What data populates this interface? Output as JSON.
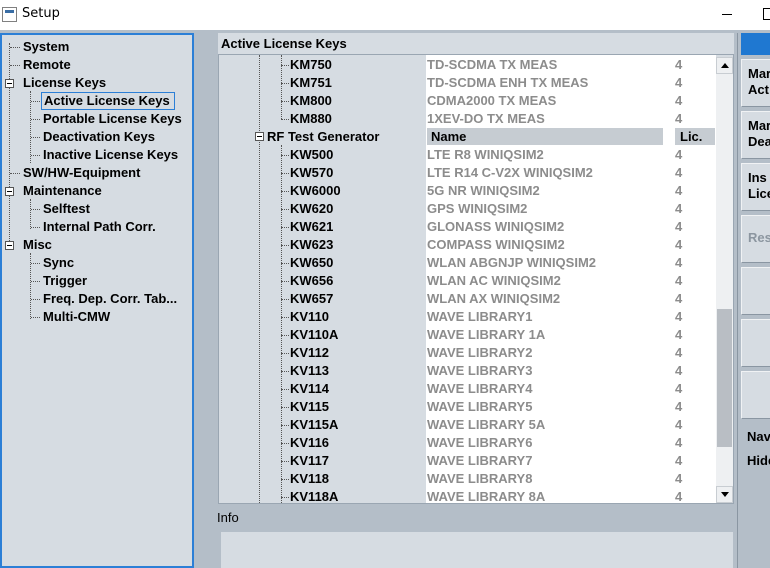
{
  "window": {
    "title": "Setup",
    "controls": [
      "minimize",
      "maximize"
    ]
  },
  "tree": {
    "items": [
      {
        "label": "System",
        "level": 1,
        "expandable": false
      },
      {
        "label": "Remote",
        "level": 1,
        "expandable": false
      },
      {
        "label": "License Keys",
        "level": 0,
        "expandable": true
      },
      {
        "label": "Active License Keys",
        "level": 2,
        "selected": true
      },
      {
        "label": "Portable License Keys",
        "level": 2
      },
      {
        "label": "Deactivation Keys",
        "level": 2
      },
      {
        "label": "Inactive License Keys",
        "level": 2
      },
      {
        "label": "SW/HW-Equipment",
        "level": 1,
        "expandable": false
      },
      {
        "label": "Maintenance",
        "level": 0,
        "expandable": true
      },
      {
        "label": "Selftest",
        "level": 2
      },
      {
        "label": "Internal Path Corr.",
        "level": 2
      },
      {
        "label": "Misc",
        "level": 0,
        "expandable": true
      },
      {
        "label": "Sync",
        "level": 2
      },
      {
        "label": "Trigger",
        "level": 2
      },
      {
        "label": "Freq. Dep. Corr. Tab...",
        "level": 2
      },
      {
        "label": "Multi-CMW",
        "level": 2
      }
    ]
  },
  "main": {
    "header": "Active License Keys",
    "columns": {
      "name": "Name",
      "lic": "Lic."
    },
    "rows_before": [
      {
        "key": "KM750",
        "name": "TD-SCDMA TX MEAS",
        "lic": "4"
      },
      {
        "key": "KM751",
        "name": "TD-SCDMA ENH TX MEAS",
        "lic": "4"
      },
      {
        "key": "KM800",
        "name": "CDMA2000 TX MEAS",
        "lic": "4"
      },
      {
        "key": "KM880",
        "name": "1XEV-DO TX MEAS",
        "lic": "4"
      }
    ],
    "group": "RF Test Generator",
    "rows_after": [
      {
        "key": "KW500",
        "name": "LTE R8 WINIQSIM2",
        "lic": "4"
      },
      {
        "key": "KW570",
        "name": "LTE R14 C-V2X WINIQSIM2",
        "lic": "4"
      },
      {
        "key": "KW6000",
        "name": "5G NR WINIQSIM2",
        "lic": "4"
      },
      {
        "key": "KW620",
        "name": "GPS WINIQSIM2",
        "lic": "4"
      },
      {
        "key": "KW621",
        "name": "GLONASS WINIQSIM2",
        "lic": "4"
      },
      {
        "key": "KW623",
        "name": "COMPASS WINIQSIM2",
        "lic": "4"
      },
      {
        "key": "KW650",
        "name": "WLAN ABGNJP WINIQSIM2",
        "lic": "4"
      },
      {
        "key": "KW656",
        "name": "WLAN AC WINIQSIM2",
        "lic": "4"
      },
      {
        "key": "KW657",
        "name": "WLAN AX WINIQSIM2",
        "lic": "4"
      },
      {
        "key": "KV110",
        "name": "WAVE LIBRARY1",
        "lic": "4"
      },
      {
        "key": "KV110A",
        "name": "WAVE LIBRARY 1A",
        "lic": "4"
      },
      {
        "key": "KV112",
        "name": "WAVE LIBRARY2",
        "lic": "4"
      },
      {
        "key": "KV113",
        "name": "WAVE LIBRARY3",
        "lic": "4"
      },
      {
        "key": "KV114",
        "name": "WAVE LIBRARY4",
        "lic": "4"
      },
      {
        "key": "KV115",
        "name": "WAVE LIBRARY5",
        "lic": "4"
      },
      {
        "key": "KV115A",
        "name": "WAVE LIBRARY 5A",
        "lic": "4"
      },
      {
        "key": "KV116",
        "name": "WAVE LIBRARY6",
        "lic": "4"
      },
      {
        "key": "KV117",
        "name": "WAVE LIBRARY7",
        "lic": "4"
      },
      {
        "key": "KV118",
        "name": "WAVE LIBRARY8",
        "lic": "4"
      },
      {
        "key": "KV118A",
        "name": "WAVE LIBRARY 8A",
        "lic": "4"
      }
    ],
    "info_label": "Info"
  },
  "right_buttons": {
    "b1": "",
    "b2a": "Mar",
    "b2b": "Act",
    "b3a": "Mar",
    "b3b": "Dea",
    "b4a": "Ins",
    "b4b": "Lice",
    "b5": "Res",
    "b6": "Navi",
    "b7": "Hide"
  },
  "colors": {
    "accent": "#1f78d1",
    "panel": "#d6dce2",
    "background": "#b4bec8",
    "muted_text": "#8c8c8c"
  }
}
